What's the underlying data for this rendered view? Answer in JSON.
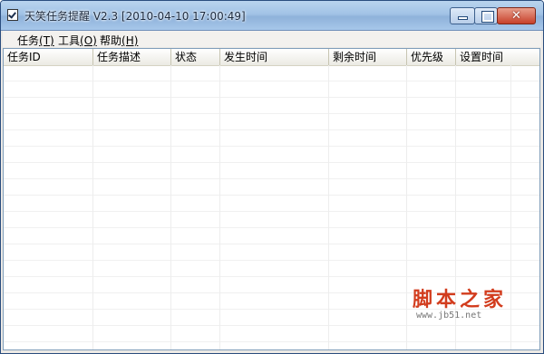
{
  "window": {
    "title": "天笑任务提醒 V2.3 [2010-04-10 17:00:49]",
    "controls": {
      "minimize": "–",
      "maximize": "□",
      "close": "✕"
    }
  },
  "menu": [
    {
      "label": "任务",
      "accel": "(T)"
    },
    {
      "label": "工具",
      "accel": "(O)"
    },
    {
      "label": "帮助",
      "accel": "(H)"
    }
  ],
  "table": {
    "columns": [
      "任务ID",
      "任务描述",
      "状态",
      "发生时间",
      "剩余时间",
      "优先级",
      "设置时间"
    ],
    "rows": []
  },
  "watermark": {
    "main": "脚本之家",
    "sub": "www.jb51.net"
  },
  "colors": {
    "title_gradient": "#a2c3e6",
    "close_button": "#c7402a",
    "watermark": "#d23c1d"
  }
}
